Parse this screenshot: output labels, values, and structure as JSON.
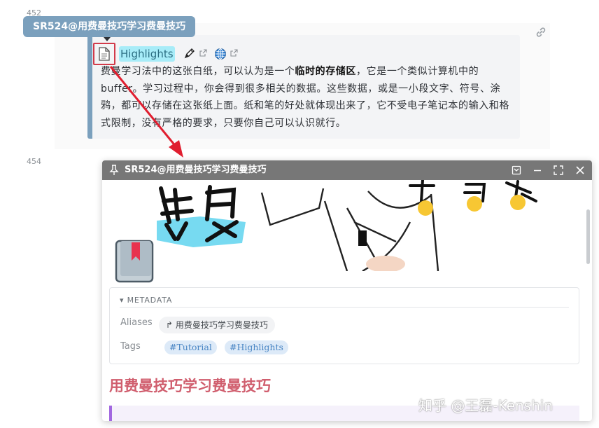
{
  "line_numbers": [
    "452",
    "454"
  ],
  "block": {
    "tag_badge": "SR524@用费曼技巧学习费曼技巧",
    "highlight_label": "Highlights",
    "paragraph_part1": "费曼学习法中的这张白纸，可以认为是一个",
    "paragraph_bold": "临时的存储区",
    "paragraph_part2": "，它是一个类似计算机中的 buffer。学习过程中，你会得到很多相关的数据。这些数据，或是一小段文字、符号、涂鸦，都可以存储在这张纸上面。纸和笔的好处就体现出来了，它不受电子笔记本的输入和格式限制，没有严格的要求，只要你自己可以认识就行。"
  },
  "panel": {
    "title": "SR524@用费曼技巧学习费曼技巧",
    "metadata_heading": "▾ METADATA",
    "aliases_label": "Aliases",
    "alias_value": "用费曼技巧学习费曼技巧",
    "tags_label": "Tags",
    "tags": [
      "#Tutorial",
      "#Highlights"
    ],
    "heading": "用费曼技巧学习费曼技巧"
  },
  "watermark": "知乎 @王磊-Kenshin",
  "colors": {
    "badge": "#7ba0bd",
    "highlight_bg": "#a7ecf8",
    "arrow": "#e01e2f",
    "heading": "#d05e6e",
    "tag_chip_bg": "#ddeaf8"
  },
  "icons": [
    "document-icon",
    "link-chain-icon",
    "pen-icon",
    "external-link-icon",
    "globe-icon",
    "pin-icon",
    "save-icon",
    "minimize-icon",
    "maximize-icon",
    "close-icon",
    "book-bookmark-icon"
  ]
}
